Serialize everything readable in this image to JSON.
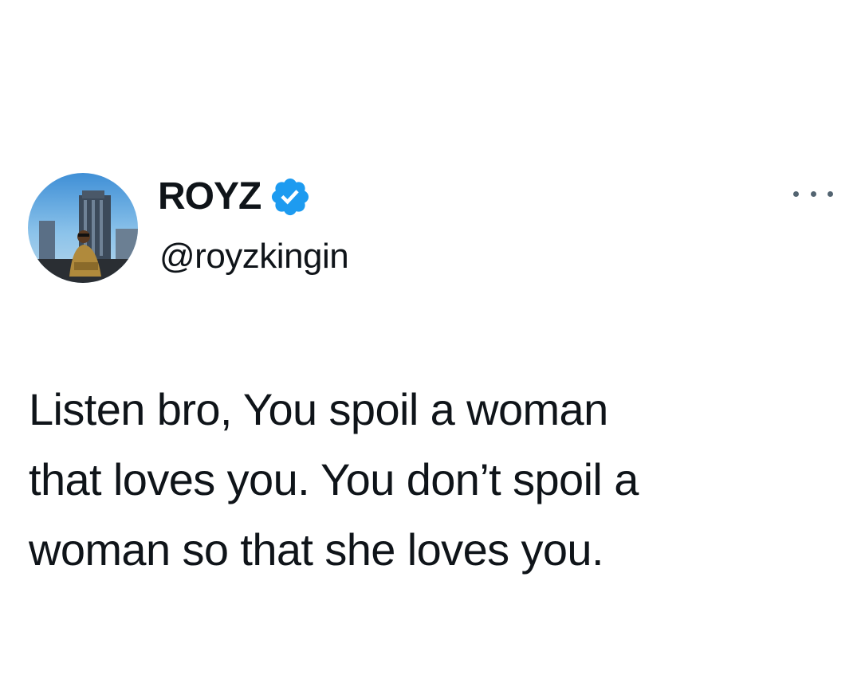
{
  "tweet": {
    "author": {
      "display_name": "ROYZ",
      "verified": true,
      "verified_icon": "verified-badge-icon",
      "handle": "@royzkingin",
      "avatar": "profile-photo"
    },
    "more_icon": "more-options-icon",
    "text_lines": [
      "Listen bro, You spoil a woman",
      "that loves you. You don’t spoil a",
      "woman so that she loves you."
    ]
  },
  "colors": {
    "text": "#0f1419",
    "verified_blue": "#1d9bf0",
    "muted": "#536471",
    "background": "#ffffff"
  }
}
